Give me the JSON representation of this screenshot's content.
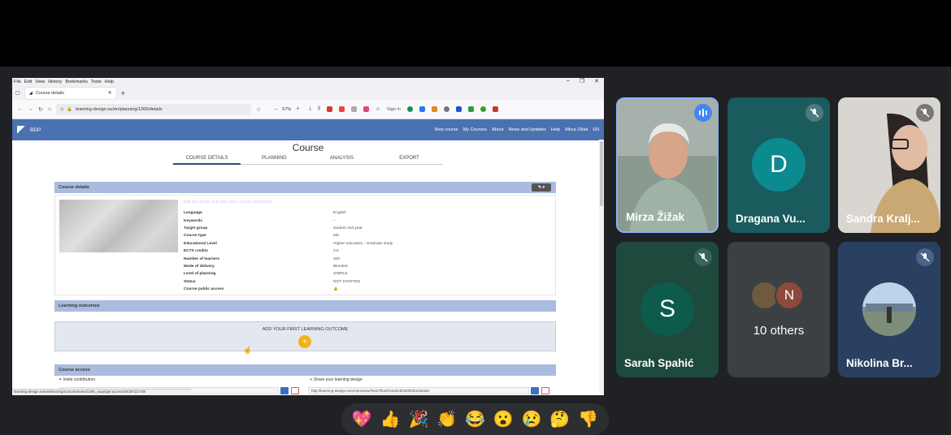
{
  "browser": {
    "menu": [
      "File",
      "Edit",
      "View",
      "History",
      "Bookmarks",
      "Tools",
      "Help"
    ],
    "tab_title": "Course details",
    "url": "learning-design.eu/en/planning/1306/details",
    "zoom": "67%",
    "sign_in": "Sign in",
    "status_url": "learning-design.eu/en/learning/outcome/new/1306_ouay/ger.access/3039721749!"
  },
  "app": {
    "logo": "BDP",
    "nav": [
      "New course",
      "My Courses",
      "About",
      "News and Updates",
      "Help",
      "Mirza Zižak",
      "EN"
    ],
    "page_title": "Course",
    "tabs": [
      "COURSE DETAILS",
      "PLANNING",
      "ANALYSIS",
      "EXPORT"
    ],
    "details_header": "Course details",
    "description_placeholder": "Edit the details and write short course description",
    "properties": [
      {
        "k": "Language",
        "v": "English"
      },
      {
        "k": "Keywords",
        "v": "–"
      },
      {
        "k": "Target group",
        "v": "student 3nd year"
      },
      {
        "k": "Course type",
        "v": "Mix"
      },
      {
        "k": "Educational Level",
        "v": "Higher education - Graduate study"
      },
      {
        "k": "ECTS credits",
        "v": "3.5"
      },
      {
        "k": "Number of learners",
        "v": "300"
      },
      {
        "k": "Mode of delivery",
        "v": "Blended"
      },
      {
        "k": "Level of planning",
        "v": "SIMPLE"
      },
      {
        "k": "Status",
        "v": "NOT STARTED"
      },
      {
        "k": "Course public access",
        "v": "🔒"
      }
    ],
    "outcomes_header": "Learning outcomes",
    "add_outcome": "ADD YOUR FIRST LEARNING OUTCOME",
    "access_header": "Course access",
    "invite": "Invite contributors",
    "share": "Share your learning design",
    "share_url": "http://learning-design.eu/en/preview/#5427fb4d7e2ebc5f493f52b1/details"
  },
  "participants": [
    {
      "name": "Mirza Žižak"
    },
    {
      "name": "Dragana Vu...",
      "initial": "D",
      "color": "#0b8a8f"
    },
    {
      "name": "Sandra Kralj..."
    },
    {
      "name": "Sarah Spahić",
      "initial": "S",
      "color": "#0d5b4b"
    },
    {
      "name": "10 others",
      "initial": "N",
      "color": "#8d4a3a"
    },
    {
      "name": "Nikolina Br..."
    }
  ],
  "reactions": [
    "💖",
    "👍",
    "🎉",
    "👏",
    "😂",
    "😮",
    "😢",
    "🤔",
    "👎"
  ]
}
